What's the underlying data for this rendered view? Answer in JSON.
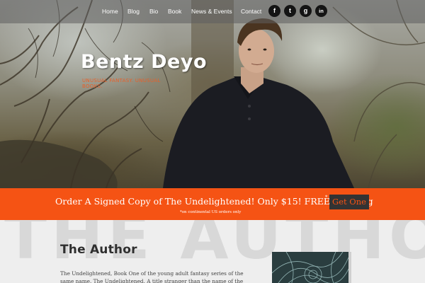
{
  "nav": {
    "links": [
      "Home",
      "Blog",
      "Bio",
      "Book",
      "News & Events",
      "Contact"
    ],
    "social": {
      "facebook": "f",
      "twitter": "t",
      "goodreads": "g",
      "linkedin": "in"
    }
  },
  "hero": {
    "name": "Bentz Deyo",
    "tagline": "UNUSUAL FANTASY. UNUSUAL BOOKS."
  },
  "banner": {
    "text": "Order A Signed Copy of The Undelightened! Only $15! FREE Shipping",
    "asterisk": "*",
    "button": "Get One",
    "note": "*on continental US orders only"
  },
  "about": {
    "background_word": "THE AUTHOR",
    "title": "The Author",
    "body": "The Undelightened, Book One of the young adult fantasy series of the same name. The Undelightened. A title stranger than the name of the"
  },
  "colors": {
    "accent": "#f55314",
    "nav_bg": "#5f5f5f",
    "button_bg": "#333333",
    "section_bg": "#eeeeee"
  }
}
